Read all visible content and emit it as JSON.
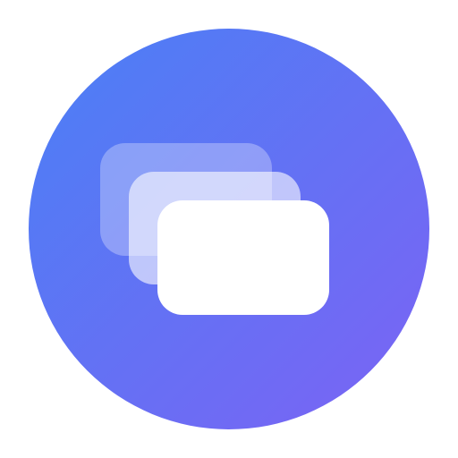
{
  "icon": {
    "name": "stacked-cards-app-icon",
    "colors": {
      "gradient_start": "#4a80f5",
      "gradient_end": "#7c63f4",
      "card_back": "#ffffff",
      "card_middle": "#ffffff",
      "card_front": "#ffffff"
    },
    "card_opacity": {
      "back": 0.3,
      "middle": 0.6,
      "front": 1.0
    }
  }
}
